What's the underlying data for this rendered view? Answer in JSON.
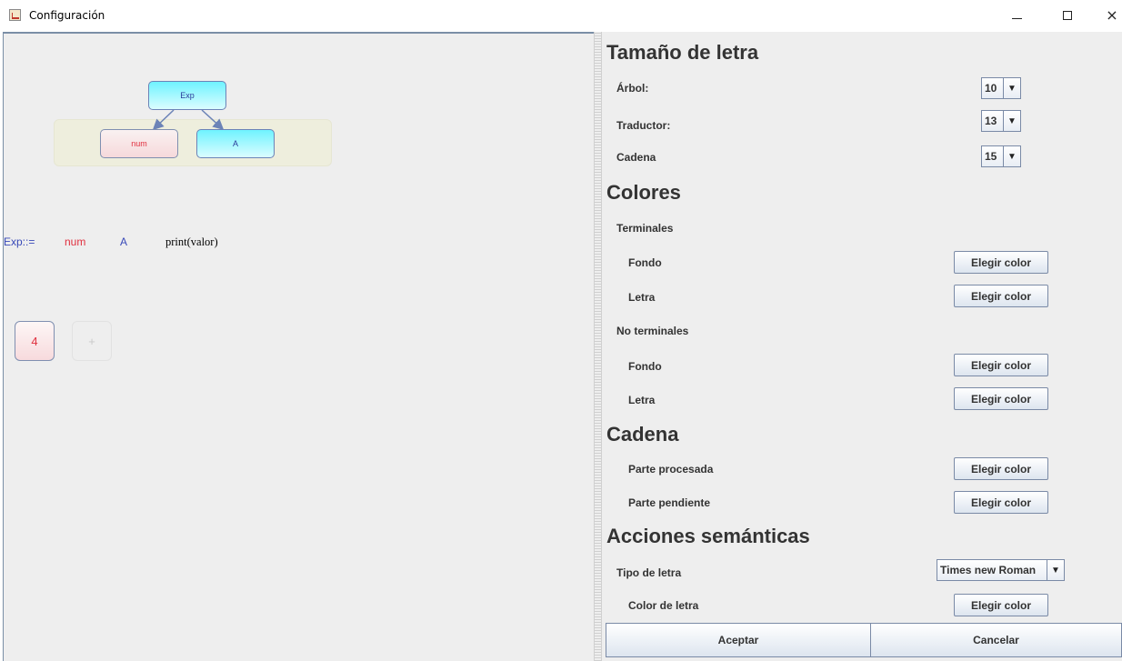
{
  "window": {
    "title": "Configuración",
    "icon": "java-cup-icon",
    "controls": {
      "minimize": "minimize-icon",
      "maximize": "maximize-icon",
      "close": "close-icon",
      "close_glyph": "×"
    }
  },
  "preview": {
    "tree": {
      "root": "Exp",
      "children": [
        "num",
        "A"
      ]
    },
    "rule": {
      "lhs": "Exp::=",
      "symbols": [
        "num",
        "A"
      ],
      "action": "print(valor)"
    },
    "string_chips": [
      "4",
      "+"
    ]
  },
  "settings": {
    "font_size": {
      "title": "Tamaño de letra",
      "rows": [
        {
          "label": "Árbol:",
          "value": "10"
        },
        {
          "label": "Traductor:",
          "value": "13"
        },
        {
          "label": "Cadena",
          "value": "15"
        }
      ]
    },
    "colors": {
      "title": "Colores",
      "terminals_label": "Terminales",
      "nonterminals_label": "No terminales",
      "background_label": "Fondo",
      "text_label": "Letra"
    },
    "chain": {
      "title": "Cadena",
      "processed_label": "Parte procesada",
      "pending_label": "Parte pendiente"
    },
    "semantic_actions": {
      "title": "Acciones semánticas",
      "font_type_label": "Tipo de letra",
      "font_type_value": "Times new Roman",
      "text_color_label": "Color de letra"
    },
    "choose_color_label": "Elegir color",
    "dropdown_arrow": "▼"
  },
  "footer": {
    "accept": "Aceptar",
    "cancel": "Cancelar"
  },
  "colors": {
    "terminal_text": "#e0303f",
    "nonterminal_text": "#3849b8",
    "nonterminal_fill": "#6ff3ff",
    "terminal_fill": "#f6d9db",
    "panel_bg": "#eeeeee"
  }
}
